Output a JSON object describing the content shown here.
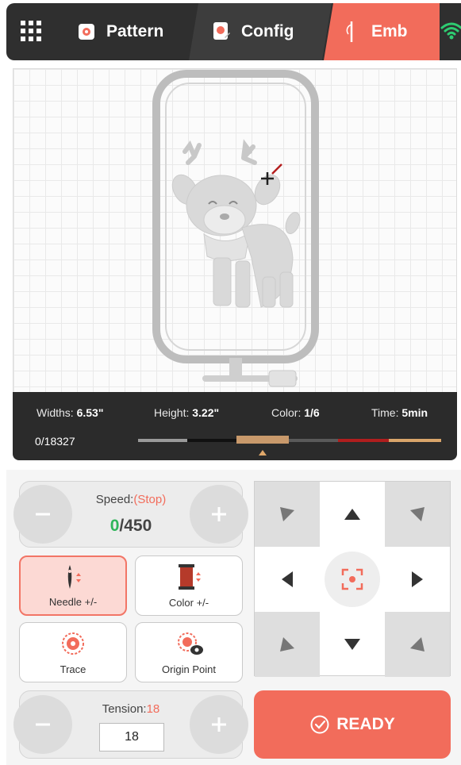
{
  "tabs": [
    {
      "label": "Pattern",
      "icon": "pattern-icon",
      "active": false
    },
    {
      "label": "Config",
      "icon": "config-icon",
      "active": false
    },
    {
      "label": "Emb",
      "icon": "needle-icon",
      "active": true
    }
  ],
  "status": {
    "wifi": "wifi-icon",
    "wifi_color": "#2ecc71"
  },
  "info": {
    "widths_label": "Widths:",
    "widths_value": "6.53\"",
    "height_label": "Height:",
    "height_value": "3.22\"",
    "color_label": "Color:",
    "color_value": "1/6",
    "time_label": "Time:",
    "time_value": "5min",
    "stitch_counter": "0/18327",
    "thread_colors": [
      "#9a9a9a",
      "#111111",
      "#c8996b",
      "#5a5a5a",
      "#b01e1e",
      "#d9a56a"
    ],
    "selected_color_index": 2
  },
  "speed": {
    "label": "Speed:",
    "state": "(Stop)",
    "current": "0",
    "max": "/450",
    "minus": "−",
    "plus": "+"
  },
  "tools": {
    "needle": "Needle +/-",
    "color": "Color +/-",
    "trace": "Trace",
    "origin": "Origin Point"
  },
  "tension": {
    "label": "Tension:",
    "value": "18",
    "input_value": "18"
  },
  "ready_label": "READY",
  "colors": {
    "accent": "#f26c5b",
    "dark": "#2f2f2f",
    "green": "#2fb55a",
    "red": "#f26c5b"
  }
}
